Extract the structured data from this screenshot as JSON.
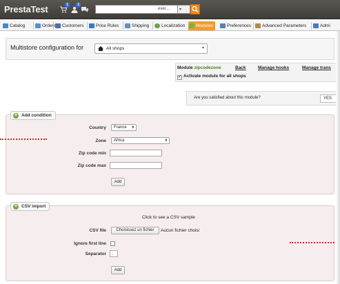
{
  "app": {
    "title": "PrestaTest"
  },
  "header": {
    "badges": {
      "orders": "1",
      "customers": "2"
    },
    "search": {
      "value": "",
      "scope": "ever…"
    }
  },
  "tabs": [
    {
      "label": "Catalog",
      "icon": "catalog-icon",
      "color": "#4a86c8"
    },
    {
      "label": "Orders",
      "icon": "orders-icon",
      "color": "#5a8fd0"
    },
    {
      "label": "Customers",
      "icon": "customers-icon",
      "color": "#4a6fa8"
    },
    {
      "label": "Price Rules",
      "icon": "price-rules-icon",
      "color": "#3c78c8"
    },
    {
      "label": "Shipping",
      "icon": "shipping-icon",
      "color": "#6b8db8"
    },
    {
      "label": "Localization",
      "icon": "localization-icon",
      "color": "#6aa24a"
    },
    {
      "label": "Modules",
      "icon": "modules-icon",
      "color": "#7cb342"
    },
    {
      "label": "Preferences",
      "icon": "preferences-icon",
      "color": "#5a7fb0"
    },
    {
      "label": "Advanced Parameters",
      "icon": "advanced-parameters-icon",
      "color": "#b08a4a"
    },
    {
      "label": "Admi",
      "icon": "administration-icon",
      "color": "#4a7ab8"
    }
  ],
  "multistore": {
    "label": "Multistore configuration for",
    "selected": "All shops"
  },
  "module_bar": {
    "prefix": "Module",
    "module_name": "zipcodezone",
    "back": "Back",
    "manage_hooks": "Manage hooks",
    "manage_trans": "Manage trans",
    "activate_label": "Activate module for all shops"
  },
  "satisfaction": {
    "question": "Are you satisfied about this module?",
    "yes": "YES"
  },
  "add_condition": {
    "legend": "Add condition",
    "country_label": "Country",
    "country_value": "France",
    "zone_label": "Zone",
    "zone_value": "Africa",
    "zip_min_label": "Zip code min",
    "zip_max_label": "Zip code max",
    "add_button": "Add"
  },
  "csv_import": {
    "legend": "CSV import",
    "sample_link": "Click to see a CSV sample",
    "file_label": "CSV file",
    "choose_button": "Choisissez un fichier",
    "no_file": "Aucun fichier choisi",
    "ignore_label": "Ignore first line",
    "separator_label": "Separator",
    "separator_value": ";",
    "add_button": "Add"
  },
  "colors": {
    "accent": "#f49b2a",
    "topbar": "#4a4844",
    "fieldset": "#f6eeee",
    "marker": "#d82020"
  }
}
